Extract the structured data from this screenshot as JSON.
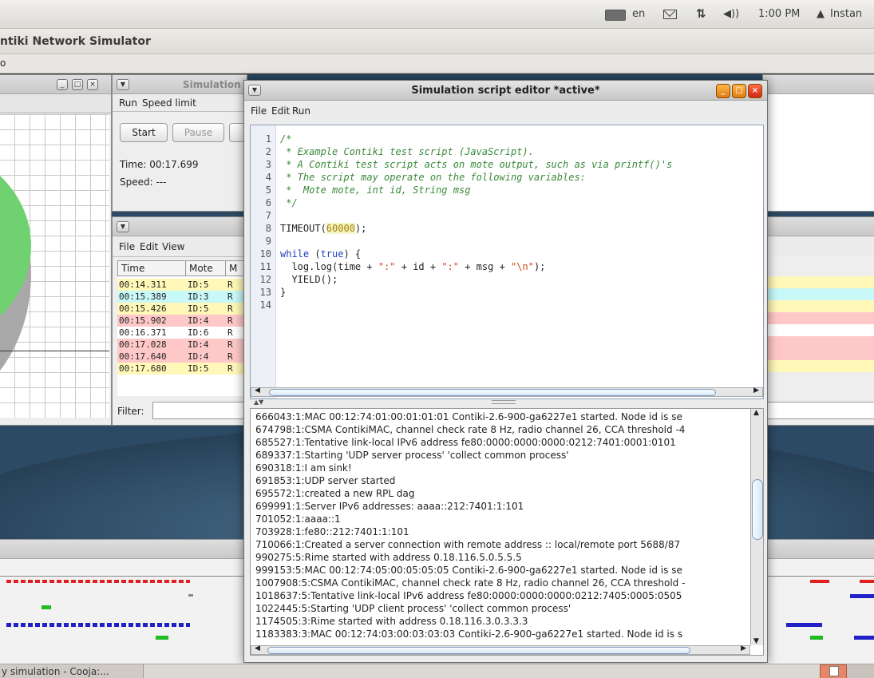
{
  "topbar": {
    "language": "en",
    "time": "1:00 PM",
    "user": "Instan"
  },
  "app": {
    "title": "ntiki Network Simulator",
    "menu_fragment": "o"
  },
  "sim_control": {
    "title": "Simulation",
    "menu": [
      "Run",
      "Speed limit"
    ],
    "start_label": "Start",
    "pause_label": "Pause",
    "time_text": "Time: 00:17.699",
    "speed_text": "Speed: ---"
  },
  "log_listener": {
    "menu": [
      "File",
      "Edit",
      "View"
    ],
    "columns": [
      "Time",
      "Mote",
      "M"
    ],
    "filter_label": "Filter:",
    "rows": [
      {
        "time": "00:14.311",
        "mote": "ID:5",
        "msg": "R",
        "color": "#fff8b8"
      },
      {
        "time": "00:15.389",
        "mote": "ID:3",
        "msg": "R",
        "color": "#c8f8f8"
      },
      {
        "time": "00:15.426",
        "mote": "ID:5",
        "msg": "R",
        "color": "#fff8b8"
      },
      {
        "time": "00:15.902",
        "mote": "ID:4",
        "msg": "R",
        "color": "#ffc8c8"
      },
      {
        "time": "00:16.371",
        "mote": "ID:6",
        "msg": "R",
        "color": "#ffffff"
      },
      {
        "time": "00:17.028",
        "mote": "ID:4",
        "msg": "R",
        "color": "#ffc8c8"
      },
      {
        "time": "00:17.640",
        "mote": "ID:4",
        "msg": "R",
        "color": "#ffc8c8"
      },
      {
        "time": "00:17.680",
        "mote": "ID:5",
        "msg": "R",
        "color": "#fff8b8"
      }
    ]
  },
  "editor": {
    "title": "Simulation script editor *active*",
    "menu": [
      "File",
      "Edit",
      "Run"
    ],
    "code": [
      {
        "n": "1",
        "parts": [
          {
            "t": "/*",
            "c": "comment"
          }
        ]
      },
      {
        "n": "2",
        "parts": [
          {
            "t": " * Example Contiki test script (JavaScript).",
            "c": "comment"
          }
        ]
      },
      {
        "n": "3",
        "parts": [
          {
            "t": " * A Contiki test script acts on mote output, such as via printf()'s",
            "c": "comment"
          }
        ]
      },
      {
        "n": "4",
        "parts": [
          {
            "t": " * The script may operate on the following variables:",
            "c": "comment"
          }
        ]
      },
      {
        "n": "5",
        "parts": [
          {
            "t": " *  Mote mote, int id, String msg",
            "c": "comment"
          }
        ]
      },
      {
        "n": "6",
        "parts": [
          {
            "t": " */",
            "c": "comment"
          }
        ]
      },
      {
        "n": "7",
        "parts": []
      },
      {
        "n": "8",
        "parts": [
          {
            "t": "TIMEOUT(",
            "c": "plain"
          },
          {
            "t": "60000",
            "c": "num"
          },
          {
            "t": ");",
            "c": "plain"
          }
        ]
      },
      {
        "n": "9",
        "parts": []
      },
      {
        "n": "10",
        "parts": [
          {
            "t": "while",
            "c": "kw"
          },
          {
            "t": " (",
            "c": "plain"
          },
          {
            "t": "true",
            "c": "kw"
          },
          {
            "t": ") {",
            "c": "plain"
          }
        ]
      },
      {
        "n": "11",
        "parts": [
          {
            "t": "  log.log(time + ",
            "c": "plain"
          },
          {
            "t": "\":\"",
            "c": "str"
          },
          {
            "t": " + id + ",
            "c": "plain"
          },
          {
            "t": "\":\"",
            "c": "str"
          },
          {
            "t": " + msg + ",
            "c": "plain"
          },
          {
            "t": "\"\\n\"",
            "c": "str"
          },
          {
            "t": ");",
            "c": "plain"
          }
        ]
      },
      {
        "n": "12",
        "parts": [
          {
            "t": "  YIELD();",
            "c": "plain"
          }
        ]
      },
      {
        "n": "13",
        "parts": [
          {
            "t": "}",
            "c": "plain"
          }
        ]
      },
      {
        "n": "14",
        "parts": []
      }
    ],
    "output": [
      "666043:1:MAC 00:12:74:01:00:01:01:01 Contiki-2.6-900-ga6227e1 started. Node id is se",
      "674798:1:CSMA ContikiMAC, channel check rate 8 Hz, radio channel 26, CCA threshold -4",
      "685527:1:Tentative link-local IPv6 address fe80:0000:0000:0000:0212:7401:0001:0101",
      "689337:1:Starting 'UDP server process' 'collect common process'",
      "690318:1:I am sink!",
      "691853:1:UDP server started",
      "695572:1:created a new RPL dag",
      "699991:1:Server IPv6 addresses: aaaa::212:7401:1:101",
      "701052:1:aaaa::1",
      "703928:1:fe80::212:7401:1:101",
      "710066:1:Created a server connection with remote address :: local/remote port 5688/87",
      "990275:5:Rime started with address 0.18.116.5.0.5.5.5",
      "999153:5:MAC 00:12:74:05:00:05:05:05 Contiki-2.6-900-ga6227e1 started. Node id is se",
      "1007908:5:CSMA ContikiMAC, channel check rate 8 Hz, radio channel 26, CCA threshold -",
      "1018637:5:Tentative link-local IPv6 address fe80:0000:0000:0000:0212:7405:0005:0505",
      "1022445:5:Starting 'UDP client process' 'collect common process'",
      "1174505:3:Rime started with address 0.18.116.3.0.3.3.3",
      "1183383:3:MAC 00:12:74:03:00:03:03:03 Contiki-2.6-900-ga6227e1 started. Node id is s"
    ]
  },
  "taskbar": {
    "item": "y simulation - Cooja:..."
  }
}
